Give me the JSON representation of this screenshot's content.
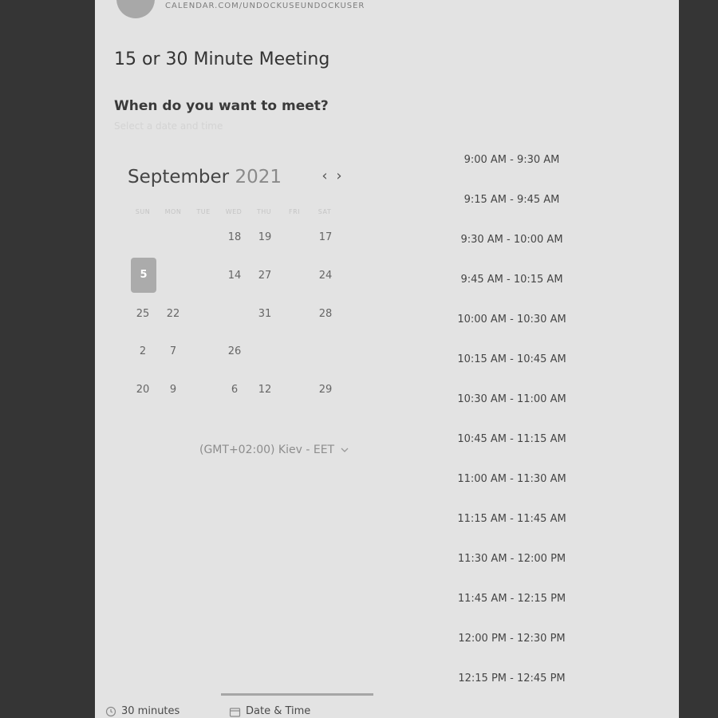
{
  "header": {
    "url": "CALENDAR.COM/UNDOCKUSEUNDOCKUSER",
    "title": "15 or 30 Minute Meeting",
    "question": "When do you want to meet?",
    "hint": "Select a date and time"
  },
  "calendar": {
    "month": "September",
    "year": "2021",
    "weekdays": [
      "SUN",
      "MON",
      "TUE",
      "WED",
      "THU",
      "FRI",
      "SAT"
    ],
    "days": [
      "18",
      "19",
      "17",
      "5",
      "14",
      "27",
      "24",
      "25",
      "22",
      "31",
      "28",
      "2",
      "7",
      "26",
      "20",
      "9",
      "6",
      "12",
      "29"
    ],
    "selected_day": "5"
  },
  "timezone": "(GMT+02:00) Kiev - EET",
  "slots": [
    "9:00 AM - 9:30 AM",
    "9:15 AM - 9:45 AM",
    "9:30 AM - 10:00 AM",
    "9:45 AM - 10:15 AM",
    "10:00 AM - 10:30 AM",
    "10:15 AM - 10:45 AM",
    "10:30 AM - 11:00 AM",
    "10:45 AM - 11:15 AM",
    "11:00 AM - 11:30 AM",
    "11:15 AM - 11:45 AM",
    "11:30 AM - 12:00 PM",
    "11:45 AM - 12:15 PM",
    "12:00 PM - 12:30 PM",
    "12:15 PM - 12:45 PM"
  ],
  "footer": {
    "duration": "30 minutes",
    "tab_label": "Date & Time"
  },
  "colors": {
    "background": "#353535",
    "panel": "#e3e3e3",
    "selected_day": "#ababab"
  },
  "icons": [
    "clock-icon",
    "calendar-icon",
    "chevron-left-icon",
    "chevron-right-icon",
    "chevron-down-icon"
  ]
}
